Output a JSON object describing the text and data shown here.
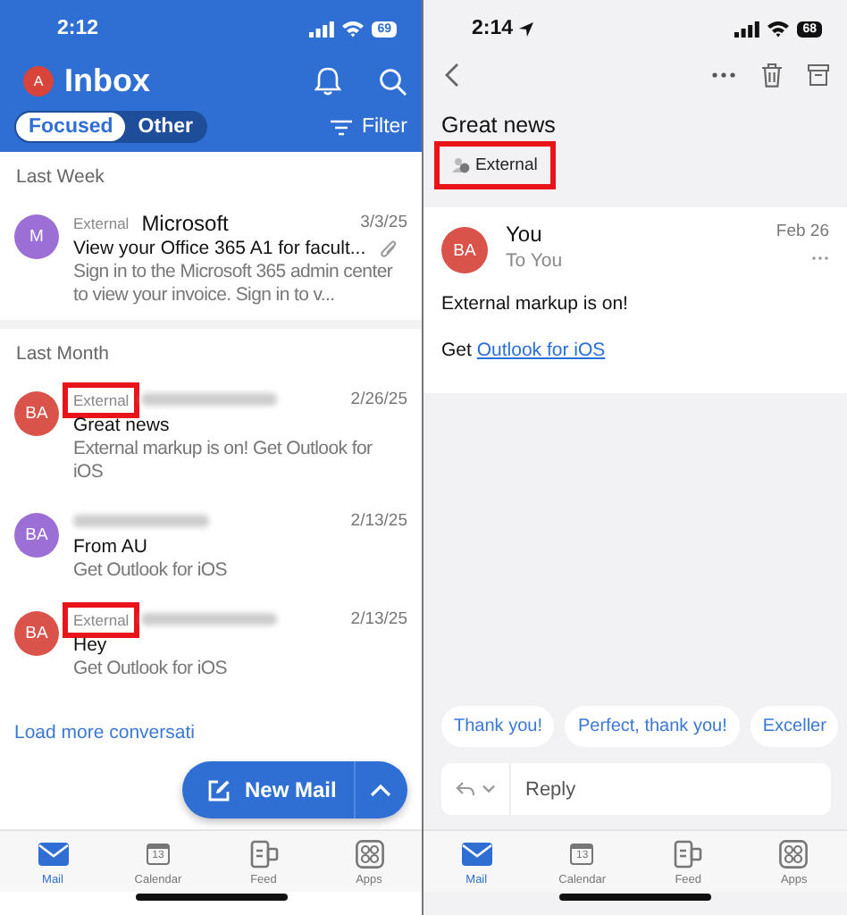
{
  "inbox_screen": {
    "status_bar": {
      "time": "2:12",
      "battery": "69"
    },
    "header": {
      "avatar_initial": "A",
      "title": "Inbox"
    },
    "tabs": [
      {
        "label": "Focused",
        "selected": true
      },
      {
        "label": "Other",
        "selected": false
      }
    ],
    "filter_label": "Filter",
    "sections": [
      {
        "title": "Last Week",
        "messages": [
          {
            "avatar": "M",
            "color": "#9c6fd6",
            "tag": "External",
            "highlighted": false,
            "sender": "Microsoft",
            "date": "3/3/25",
            "subject": "View your Office 365 A1 for facult...",
            "attachment": true,
            "preview": "Sign in to the Microsoft 365 admin center to view your invoice. Sign in to v..."
          }
        ]
      },
      {
        "title": "Last Month",
        "messages": [
          {
            "avatar": "BA",
            "color": "#d9534a",
            "tag": "External",
            "highlighted": true,
            "date": "2/26/25",
            "subject": "Great news",
            "attachment": false,
            "preview": "External markup is on! Get Outlook for iOS"
          },
          {
            "avatar": "BA",
            "color": "#9c6fd6",
            "date": "2/13/25",
            "subject": "From AU",
            "attachment": false,
            "preview": "Get Outlook for iOS"
          },
          {
            "avatar": "BA",
            "color": "#d9534a",
            "tag": "External",
            "highlighted": true,
            "date": "2/13/25",
            "subject": "Hey",
            "attachment": false,
            "preview": "Get Outlook for iOS"
          }
        ]
      }
    ],
    "load_more": "Load more conversati",
    "new_mail_button": "New Mail",
    "tab_bar": [
      {
        "kind": "mail",
        "label": "Mail",
        "selected": true
      },
      {
        "kind": "calendar",
        "label": "Calendar",
        "icon_text": "13",
        "selected": false
      },
      {
        "kind": "feed",
        "label": "Feed",
        "selected": false
      },
      {
        "kind": "apps",
        "label": "Apps",
        "selected": false
      }
    ]
  },
  "message_screen": {
    "status_bar": {
      "time": "2:14",
      "battery": "68"
    },
    "subject": "Great news",
    "external_tag": {
      "label": "External",
      "highlighted": true
    },
    "message": {
      "avatar": "BA",
      "color": "#d9534a",
      "from": "You",
      "to": "To You",
      "date": "Feb 26",
      "body": "External markup is on!",
      "link_prefix": "Get",
      "link": "Outlook for iOS"
    },
    "quick_replies": [
      "Thank you!",
      "Perfect, thank you!",
      "Exceller"
    ],
    "reply_placeholder": "Reply",
    "tab_bar": [
      {
        "kind": "mail",
        "label": "Mail",
        "selected": true
      },
      {
        "kind": "calendar",
        "label": "Calendar",
        "icon_text": "13",
        "selected": false
      },
      {
        "kind": "feed",
        "label": "Feed",
        "selected": false
      },
      {
        "kind": "apps",
        "label": "Apps",
        "selected": false
      }
    ]
  }
}
